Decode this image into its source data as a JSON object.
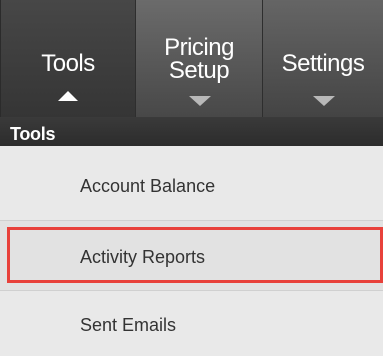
{
  "nav": {
    "tabs": [
      {
        "label": "Tools",
        "state": "expanded",
        "icon": "chevron-up-icon"
      },
      {
        "label": "Pricing Setup",
        "state": "collapsed",
        "icon": "chevron-down-icon"
      },
      {
        "label": "Settings",
        "state": "collapsed",
        "icon": "chevron-down-icon"
      }
    ],
    "section_label": "Tools"
  },
  "menu": {
    "items": [
      {
        "label": "Account Balance"
      },
      {
        "label": "Activity Reports",
        "highlighted": true
      },
      {
        "label": "Sent Emails"
      }
    ]
  },
  "colors": {
    "highlight_border": "#e8413b",
    "nav_background": "#4a4a4a",
    "menu_background": "#e9e9e9"
  }
}
